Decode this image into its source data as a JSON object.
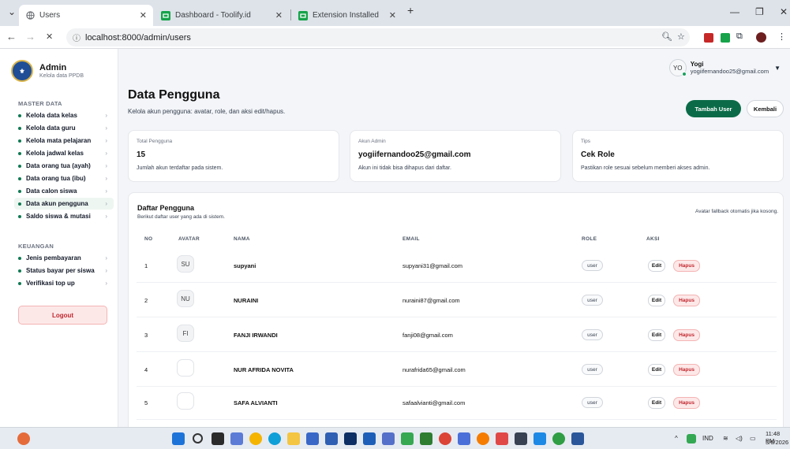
{
  "browser": {
    "tabs": [
      {
        "title": "Users",
        "active": true
      },
      {
        "title": "Dashboard - Toolify.id",
        "active": false
      },
      {
        "title": "Extension Installed",
        "active": false
      }
    ],
    "url": "localhost:8000/admin/users"
  },
  "sidebar": {
    "brand_title": "Admin",
    "brand_sub": "Kelola data PPDB",
    "sections": [
      {
        "label": "MASTER DATA",
        "items": [
          {
            "label": "Kelola data kelas"
          },
          {
            "label": "Kelola data guru"
          },
          {
            "label": "Kelola mata pelajaran"
          },
          {
            "label": "Kelola jadwal kelas"
          },
          {
            "label": "Data orang tua (ayah)"
          },
          {
            "label": "Data orang tua (ibu)"
          },
          {
            "label": "Data calon siswa"
          },
          {
            "label": "Data akun pengguna"
          },
          {
            "label": "Saldo siswa & mutasi"
          }
        ]
      },
      {
        "label": "KEUANGAN",
        "items": [
          {
            "label": "Jenis pembayaran"
          },
          {
            "label": "Status bayar per siswa"
          },
          {
            "label": "Verifikasi top up"
          }
        ]
      }
    ],
    "logout_label": "Logout"
  },
  "user": {
    "initials": "YO",
    "name": "Yogi",
    "email": "yogiifernandoo25@gmail.com"
  },
  "page": {
    "title": "Data Pengguna",
    "subtitle": "Kelola akun pengguna: avatar, role, dan aksi edit/hapus.",
    "add_button": "Tambah User",
    "back_button": "Kembali"
  },
  "cards": [
    {
      "label": "Total Pengguna",
      "value": "15",
      "desc": "Jumlah akun terdaftar pada sistem."
    },
    {
      "label": "Akun Admin",
      "value": "yogiifernandoo25@gmail.com",
      "desc": "Akun ini tidak bisa dihapus dari daftar."
    },
    {
      "label": "Tips",
      "value": "Cek Role",
      "desc": "Pastikan role sesuai sebelum memberi akses admin."
    }
  ],
  "table": {
    "title": "Daftar Pengguna",
    "subtitle": "Berikut daftar user yang ada di sistem.",
    "note": "Avatar fallback otomatis jika kosong.",
    "headers": [
      "NO",
      "AVATAR",
      "NAMA",
      "EMAIL",
      "ROLE",
      "AKSI"
    ],
    "rows": [
      {
        "no": "1",
        "avatar": "SU",
        "name": "supyani",
        "email": "supyani31@gmail.com",
        "role": "user"
      },
      {
        "no": "2",
        "avatar": "NU",
        "name": "NURAINI",
        "email": "nuraini87@gmail.com",
        "role": "user"
      },
      {
        "no": "3",
        "avatar": "FI",
        "name": "FANJI IRWANDI",
        "email": "fanji08@gmail.com",
        "role": "user"
      },
      {
        "no": "4",
        "avatar": "",
        "name": "NUR AFRIDA NOVITA",
        "email": "nurafrida65@gmail.com",
        "role": "user"
      },
      {
        "no": "5",
        "avatar": "",
        "name": "SAFA ALVIANTI",
        "email": "safaalvianti@gmail.com",
        "role": "user"
      }
    ],
    "edit_label": "Edit",
    "delete_label": "Hapus"
  },
  "taskbar": {
    "language": "IND",
    "time": "11:48 PM",
    "date": "3/6/2026"
  }
}
